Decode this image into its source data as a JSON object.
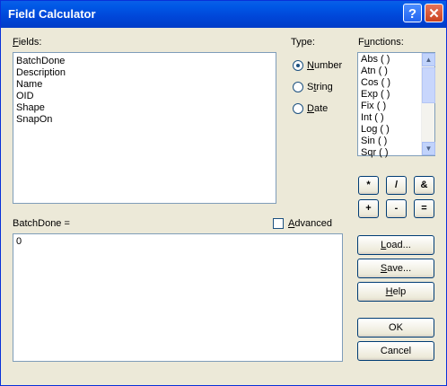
{
  "window": {
    "title": "Field Calculator"
  },
  "fields": {
    "label": "Fields:",
    "items": [
      "BatchDone",
      "Description",
      "Name",
      "OID",
      "Shape",
      "SnapOn"
    ]
  },
  "type": {
    "label": "Type:",
    "options": [
      {
        "label": "Number",
        "checked": true
      },
      {
        "label": "String",
        "checked": false
      },
      {
        "label": "Date",
        "checked": false
      }
    ]
  },
  "functions": {
    "label": "Functions:",
    "items": [
      "Abs ( )",
      "Atn ( )",
      "Cos ( )",
      "Exp ( )",
      "Fix ( )",
      "Int ( )",
      "Log ( )",
      "Sin ( )",
      "Sqr ( )"
    ]
  },
  "operators": [
    "*",
    "/",
    "&",
    "+",
    "-",
    "="
  ],
  "expression": {
    "label": "BatchDone =",
    "value": "0",
    "advanced_label": "Advanced",
    "advanced_checked": false
  },
  "buttons": {
    "load": "Load...",
    "save": "Save...",
    "help": "Help",
    "ok": "OK",
    "cancel": "Cancel"
  }
}
